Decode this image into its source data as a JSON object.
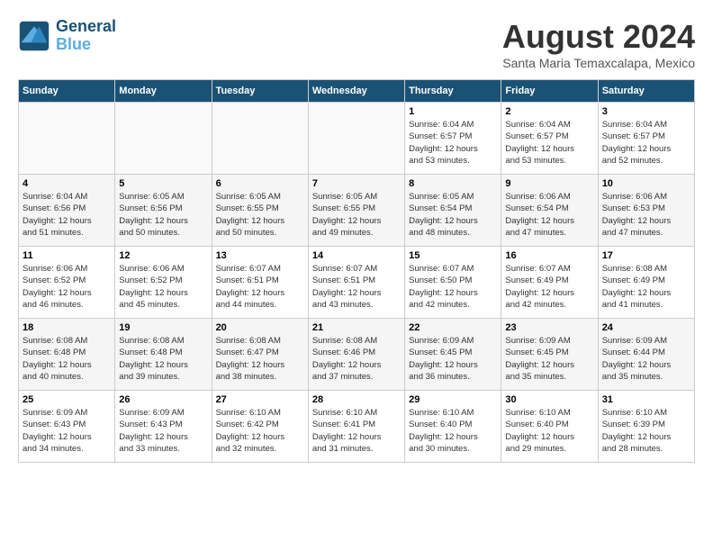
{
  "header": {
    "logo_line1": "General",
    "logo_line2": "Blue",
    "title": "August 2024",
    "subtitle": "Santa Maria Temaxcalapa, Mexico"
  },
  "days_of_week": [
    "Sunday",
    "Monday",
    "Tuesday",
    "Wednesday",
    "Thursday",
    "Friday",
    "Saturday"
  ],
  "weeks": [
    [
      {
        "day": "",
        "content": ""
      },
      {
        "day": "",
        "content": ""
      },
      {
        "day": "",
        "content": ""
      },
      {
        "day": "",
        "content": ""
      },
      {
        "day": "1",
        "content": "Sunrise: 6:04 AM\nSunset: 6:57 PM\nDaylight: 12 hours\nand 53 minutes."
      },
      {
        "day": "2",
        "content": "Sunrise: 6:04 AM\nSunset: 6:57 PM\nDaylight: 12 hours\nand 53 minutes."
      },
      {
        "day": "3",
        "content": "Sunrise: 6:04 AM\nSunset: 6:57 PM\nDaylight: 12 hours\nand 52 minutes."
      }
    ],
    [
      {
        "day": "4",
        "content": "Sunrise: 6:04 AM\nSunset: 6:56 PM\nDaylight: 12 hours\nand 51 minutes."
      },
      {
        "day": "5",
        "content": "Sunrise: 6:05 AM\nSunset: 6:56 PM\nDaylight: 12 hours\nand 50 minutes."
      },
      {
        "day": "6",
        "content": "Sunrise: 6:05 AM\nSunset: 6:55 PM\nDaylight: 12 hours\nand 50 minutes."
      },
      {
        "day": "7",
        "content": "Sunrise: 6:05 AM\nSunset: 6:55 PM\nDaylight: 12 hours\nand 49 minutes."
      },
      {
        "day": "8",
        "content": "Sunrise: 6:05 AM\nSunset: 6:54 PM\nDaylight: 12 hours\nand 48 minutes."
      },
      {
        "day": "9",
        "content": "Sunrise: 6:06 AM\nSunset: 6:54 PM\nDaylight: 12 hours\nand 47 minutes."
      },
      {
        "day": "10",
        "content": "Sunrise: 6:06 AM\nSunset: 6:53 PM\nDaylight: 12 hours\nand 47 minutes."
      }
    ],
    [
      {
        "day": "11",
        "content": "Sunrise: 6:06 AM\nSunset: 6:52 PM\nDaylight: 12 hours\nand 46 minutes."
      },
      {
        "day": "12",
        "content": "Sunrise: 6:06 AM\nSunset: 6:52 PM\nDaylight: 12 hours\nand 45 minutes."
      },
      {
        "day": "13",
        "content": "Sunrise: 6:07 AM\nSunset: 6:51 PM\nDaylight: 12 hours\nand 44 minutes."
      },
      {
        "day": "14",
        "content": "Sunrise: 6:07 AM\nSunset: 6:51 PM\nDaylight: 12 hours\nand 43 minutes."
      },
      {
        "day": "15",
        "content": "Sunrise: 6:07 AM\nSunset: 6:50 PM\nDaylight: 12 hours\nand 42 minutes."
      },
      {
        "day": "16",
        "content": "Sunrise: 6:07 AM\nSunset: 6:49 PM\nDaylight: 12 hours\nand 42 minutes."
      },
      {
        "day": "17",
        "content": "Sunrise: 6:08 AM\nSunset: 6:49 PM\nDaylight: 12 hours\nand 41 minutes."
      }
    ],
    [
      {
        "day": "18",
        "content": "Sunrise: 6:08 AM\nSunset: 6:48 PM\nDaylight: 12 hours\nand 40 minutes."
      },
      {
        "day": "19",
        "content": "Sunrise: 6:08 AM\nSunset: 6:48 PM\nDaylight: 12 hours\nand 39 minutes."
      },
      {
        "day": "20",
        "content": "Sunrise: 6:08 AM\nSunset: 6:47 PM\nDaylight: 12 hours\nand 38 minutes."
      },
      {
        "day": "21",
        "content": "Sunrise: 6:08 AM\nSunset: 6:46 PM\nDaylight: 12 hours\nand 37 minutes."
      },
      {
        "day": "22",
        "content": "Sunrise: 6:09 AM\nSunset: 6:45 PM\nDaylight: 12 hours\nand 36 minutes."
      },
      {
        "day": "23",
        "content": "Sunrise: 6:09 AM\nSunset: 6:45 PM\nDaylight: 12 hours\nand 35 minutes."
      },
      {
        "day": "24",
        "content": "Sunrise: 6:09 AM\nSunset: 6:44 PM\nDaylight: 12 hours\nand 35 minutes."
      }
    ],
    [
      {
        "day": "25",
        "content": "Sunrise: 6:09 AM\nSunset: 6:43 PM\nDaylight: 12 hours\nand 34 minutes."
      },
      {
        "day": "26",
        "content": "Sunrise: 6:09 AM\nSunset: 6:43 PM\nDaylight: 12 hours\nand 33 minutes."
      },
      {
        "day": "27",
        "content": "Sunrise: 6:10 AM\nSunset: 6:42 PM\nDaylight: 12 hours\nand 32 minutes."
      },
      {
        "day": "28",
        "content": "Sunrise: 6:10 AM\nSunset: 6:41 PM\nDaylight: 12 hours\nand 31 minutes."
      },
      {
        "day": "29",
        "content": "Sunrise: 6:10 AM\nSunset: 6:40 PM\nDaylight: 12 hours\nand 30 minutes."
      },
      {
        "day": "30",
        "content": "Sunrise: 6:10 AM\nSunset: 6:40 PM\nDaylight: 12 hours\nand 29 minutes."
      },
      {
        "day": "31",
        "content": "Sunrise: 6:10 AM\nSunset: 6:39 PM\nDaylight: 12 hours\nand 28 minutes."
      }
    ]
  ]
}
